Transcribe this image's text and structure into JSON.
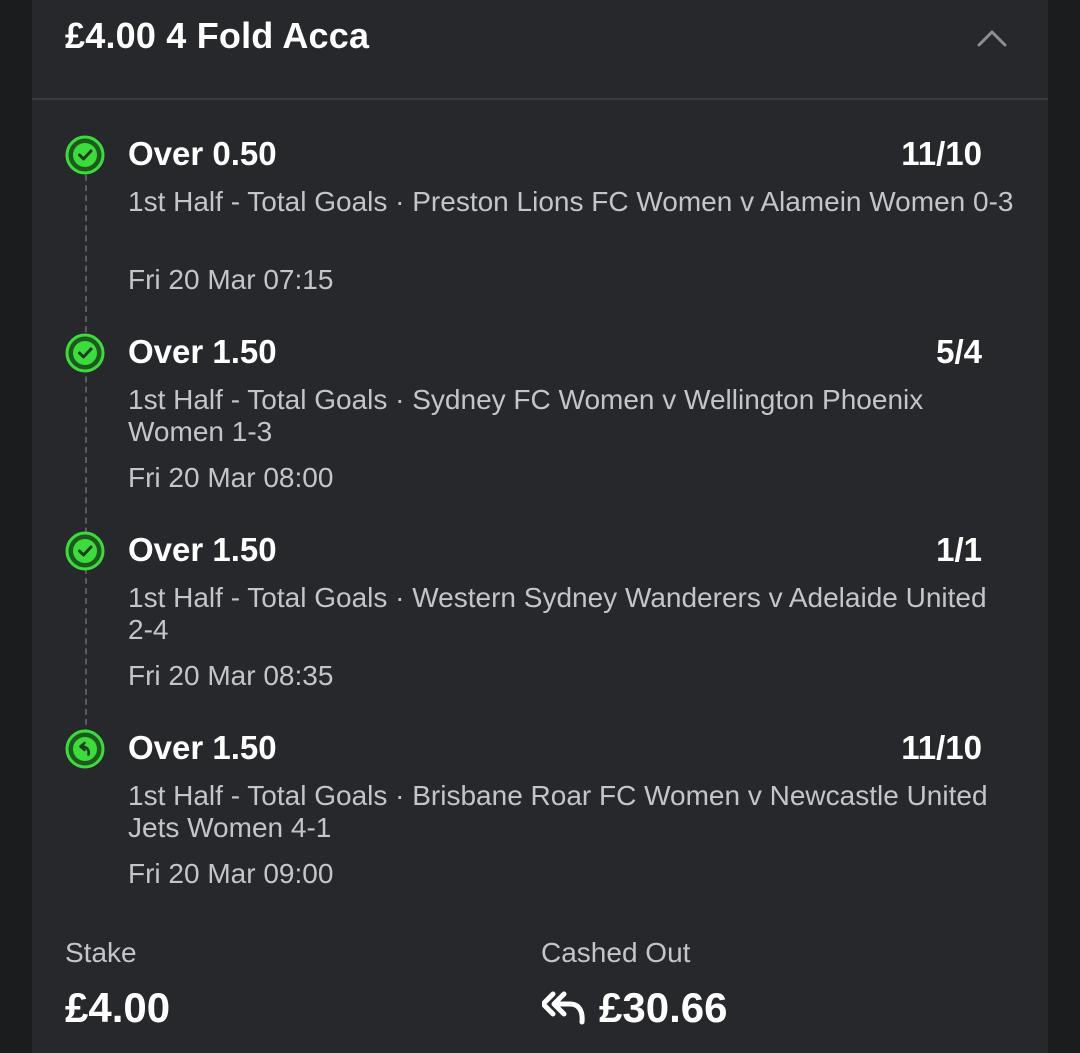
{
  "header": {
    "title": "£4.00 4 Fold Acca",
    "collapse_icon": "chevron-up-icon"
  },
  "legs": [
    {
      "selection": "Over 0.50",
      "odds": "11/10",
      "market": "1st Half - Total Goals · Preston Lions FC Women v Alamein Women 0-3",
      "time": "Fri 20 Mar 07:15",
      "status_icon": "check-circle-icon"
    },
    {
      "selection": "Over 1.50",
      "odds": "5/4",
      "market": "1st Half - Total Goals · Sydney FC Women v Wellington Phoenix Women 1-3",
      "time": "Fri 20 Mar 08:00",
      "status_icon": "check-circle-icon"
    },
    {
      "selection": "Over 1.50",
      "odds": "1/1",
      "market": "1st Half - Total Goals · Western Sydney Wanderers v Adelaide United 2-4",
      "time": "Fri 20 Mar 08:35",
      "status_icon": "check-circle-icon"
    },
    {
      "selection": "Over 1.50",
      "odds": "11/10",
      "market": "1st Half - Total Goals · Brisbane Roar FC Women v Newcastle United Jets Women 4-1",
      "time": "Fri 20 Mar 09:00",
      "status_icon": "cashed-out-circle-icon"
    }
  ],
  "summary": {
    "stake_label": "Stake",
    "stake_value": "£4.00",
    "cashout_label": "Cashed Out",
    "cashout_value": "£30.66",
    "cashout_icon": "double-reply-arrow-icon"
  },
  "colors": {
    "page_background": "#1b1c1e",
    "card_background": "#27282b",
    "accent_green": "#3ddc3d",
    "secondary_text": "#c4c5c8"
  }
}
